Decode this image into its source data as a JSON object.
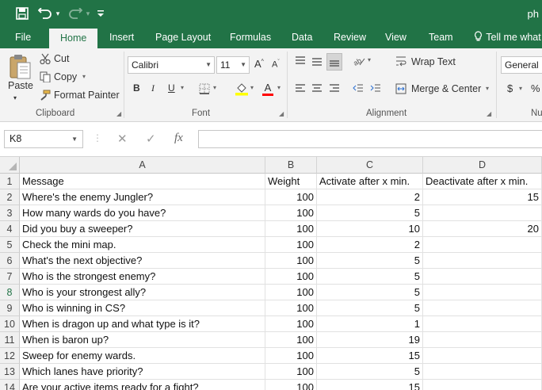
{
  "titlebar": {
    "doc_title": "ph",
    "save_glyph": "💾",
    "undo_glyph": "↶",
    "redo_glyph": "↷",
    "caret_glyph": "▾",
    "customize_glyph": "▾"
  },
  "tabs": [
    "File",
    "Home",
    "Insert",
    "Page Layout",
    "Formulas",
    "Data",
    "Review",
    "View",
    "Team",
    "Tell me what"
  ],
  "active_tab": "Home",
  "clipboard": {
    "paste": "Paste",
    "cut": "Cut",
    "copy": "Copy",
    "format_painter": "Format Painter",
    "label": "Clipboard"
  },
  "font": {
    "name": "Calibri",
    "size": "11",
    "grow": "A",
    "shrink": "A",
    "bold": "B",
    "italic": "I",
    "underline": "U",
    "fontcolor": "A",
    "label": "Font"
  },
  "alignment": {
    "wrap_text": "Wrap Text",
    "merge_center": "Merge & Center",
    "label": "Alignment"
  },
  "number": {
    "format": "General",
    "currency": "$",
    "percent": "%",
    "label": "Nu"
  },
  "formula_bar": {
    "name_box": "K8",
    "cancel": "✕",
    "enter": "✓",
    "fx": "fx",
    "content": ""
  },
  "sheet": {
    "columns": [
      "A",
      "B",
      "C",
      "D"
    ],
    "selected_row": 8,
    "rows": [
      {
        "n": "1",
        "a": "Message",
        "b": "Weight",
        "c": "Activate after x min.",
        "d": "Deactivate after x min."
      },
      {
        "n": "2",
        "a": "Where's the enemy Jungler?",
        "b": "100",
        "c": "2",
        "d": "15"
      },
      {
        "n": "3",
        "a": "How many wards do you have?",
        "b": "100",
        "c": "5",
        "d": ""
      },
      {
        "n": "4",
        "a": "Did you buy a sweeper?",
        "b": "100",
        "c": "10",
        "d": "20"
      },
      {
        "n": "5",
        "a": "Check the mini map.",
        "b": "100",
        "c": "2",
        "d": ""
      },
      {
        "n": "6",
        "a": "What's the next objective?",
        "b": "100",
        "c": "5",
        "d": ""
      },
      {
        "n": "7",
        "a": "Who is the strongest enemy?",
        "b": "100",
        "c": "5",
        "d": ""
      },
      {
        "n": "8",
        "a": "Who is your strongest ally?",
        "b": "100",
        "c": "5",
        "d": ""
      },
      {
        "n": "9",
        "a": "Who is winning in CS?",
        "b": "100",
        "c": "5",
        "d": ""
      },
      {
        "n": "10",
        "a": "When is dragon up and what type is it?",
        "b": "100",
        "c": "1",
        "d": ""
      },
      {
        "n": "11",
        "a": "When is baron up?",
        "b": "100",
        "c": "19",
        "d": ""
      },
      {
        "n": "12",
        "a": "Sweep for enemy wards.",
        "b": "100",
        "c": "15",
        "d": ""
      },
      {
        "n": "13",
        "a": "Which lanes have priority?",
        "b": "100",
        "c": "5",
        "d": ""
      },
      {
        "n": "14",
        "a": "Are your active items ready for a fight?",
        "b": "100",
        "c": "15",
        "d": ""
      }
    ]
  }
}
